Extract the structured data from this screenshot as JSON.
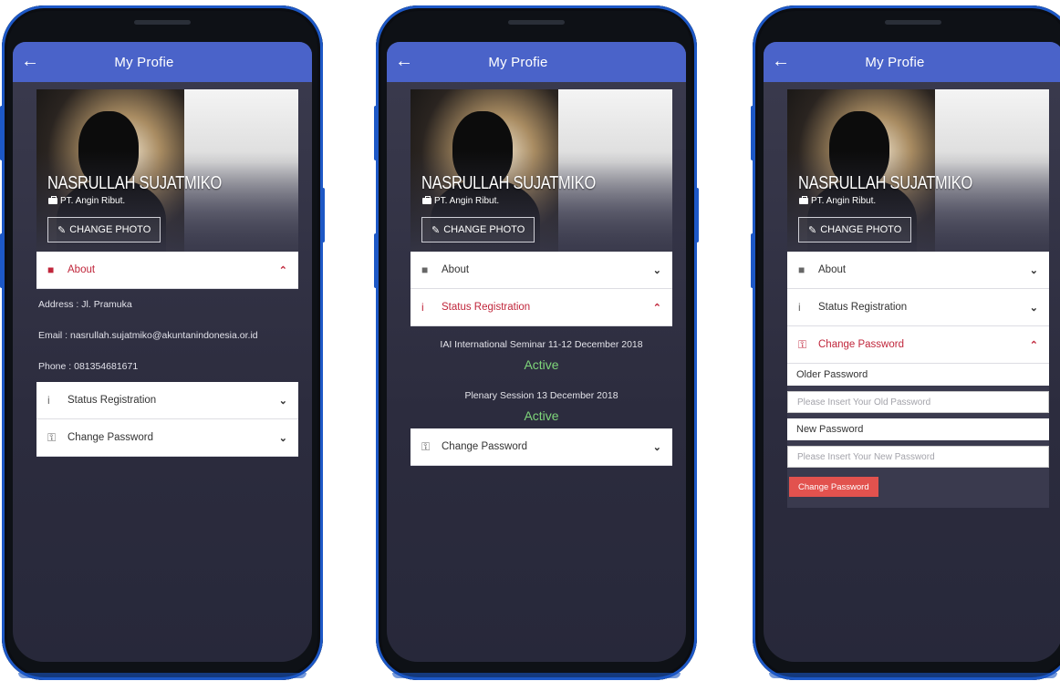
{
  "app": {
    "title": "My Profie",
    "profile": {
      "name": "NASRULLAH SUJATMIKO",
      "company": "PT. Angin Ribut.",
      "change_photo_label": "CHANGE PHOTO"
    },
    "sections": {
      "about": "About",
      "status_registration": "Status Registration",
      "change_password": "Change Password"
    }
  },
  "screen1": {
    "about": {
      "address": "Address : Jl. Pramuka",
      "email": "Email : nasrullah.sujatmiko@akuntanindonesia.or.id",
      "phone": "Phone : 081354681671"
    }
  },
  "screen2": {
    "registrations": [
      {
        "event": "IAI International Seminar 11-12 December 2018",
        "status": "Active"
      },
      {
        "event": "Plenary Session 13 December 2018",
        "status": "Active"
      }
    ]
  },
  "screen3": {
    "old_label": "Older Password",
    "old_placeholder": "Please Insert Your Old Password",
    "new_label": "New Password",
    "new_placeholder": "Please Insert Your New Password",
    "submit_label": "Change Password"
  },
  "colors": {
    "appbar": "#4a63c9",
    "phone_frame": "#1d58c6",
    "accent_red": "#c0263b",
    "active_green": "#7ed57a",
    "button_red": "#e2524e"
  }
}
